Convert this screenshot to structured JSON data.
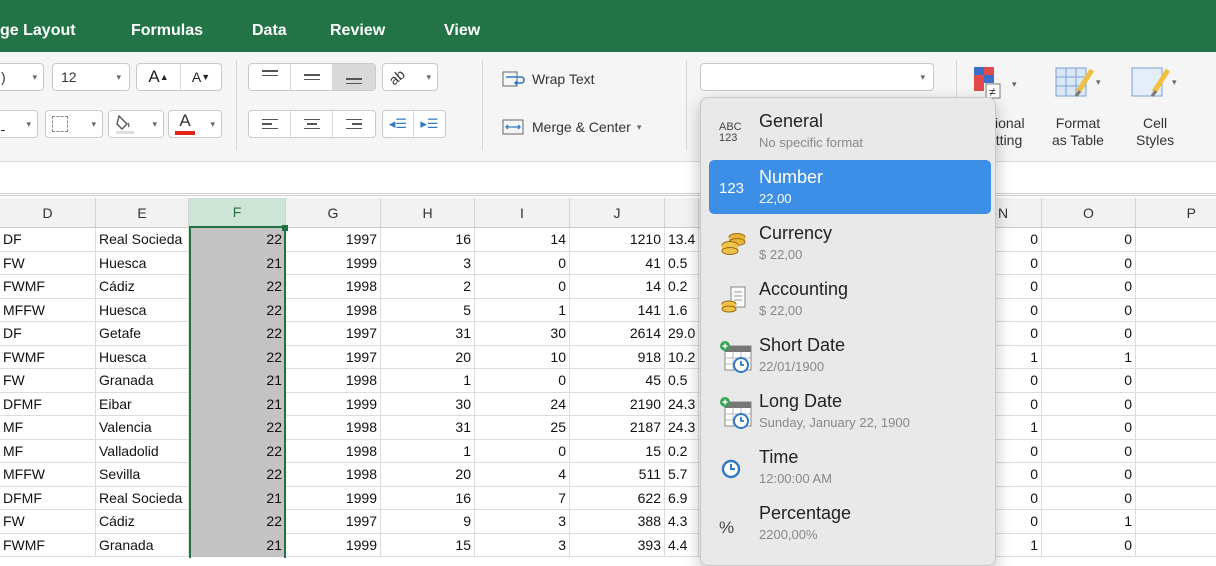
{
  "tabs": [
    "ge Layout",
    "Formulas",
    "Data",
    "Review",
    "View"
  ],
  "ribbon": {
    "font_name_partial": ")",
    "font_size": "12",
    "wrap_text": "Wrap Text",
    "merge_center": "Merge & Center",
    "number_format_value": "",
    "conditional_formatting": [
      "itional",
      "atting"
    ],
    "format_as_table": [
      "Format",
      "as Table"
    ],
    "cell_styles": [
      "Cell",
      "Styles"
    ]
  },
  "columns": [
    "D",
    "E",
    "F",
    "G",
    "H",
    "I",
    "J",
    "N",
    "O",
    "P"
  ],
  "rows": [
    [
      "DF",
      "Real Socieda",
      "22",
      "1997",
      "16",
      "14",
      "1210",
      "13.4",
      "0",
      "0"
    ],
    [
      "FW",
      "Huesca",
      "21",
      "1999",
      "3",
      "0",
      "41",
      "0.5",
      "0",
      "0"
    ],
    [
      "FWMF",
      "Cádiz",
      "22",
      "1998",
      "2",
      "0",
      "14",
      "0.2",
      "0",
      "0"
    ],
    [
      "MFFW",
      "Huesca",
      "22",
      "1998",
      "5",
      "1",
      "141",
      "1.6",
      "0",
      "0"
    ],
    [
      "DF",
      "Getafe",
      "22",
      "1997",
      "31",
      "30",
      "2614",
      "29.0",
      "0",
      "0"
    ],
    [
      "FWMF",
      "Huesca",
      "22",
      "1997",
      "20",
      "10",
      "918",
      "10.2",
      "1",
      "1"
    ],
    [
      "FW",
      "Granada",
      "21",
      "1998",
      "1",
      "0",
      "45",
      "0.5",
      "0",
      "0"
    ],
    [
      "DFMF",
      "Eibar",
      "21",
      "1999",
      "30",
      "24",
      "2190",
      "24.3",
      "0",
      "0"
    ],
    [
      "MF",
      "Valencia",
      "22",
      "1998",
      "31",
      "25",
      "2187",
      "24.3",
      "1",
      "0"
    ],
    [
      "MF",
      "Valladolid",
      "22",
      "1998",
      "1",
      "0",
      "15",
      "0.2",
      "0",
      "0"
    ],
    [
      "MFFW",
      "Sevilla",
      "22",
      "1998",
      "20",
      "4",
      "511",
      "5.7",
      "0",
      "0"
    ],
    [
      "DFMF",
      "Real Socieda",
      "21",
      "1999",
      "16",
      "7",
      "622",
      "6.9",
      "0",
      "0"
    ],
    [
      "FW",
      "Cádiz",
      "22",
      "1997",
      "9",
      "3",
      "388",
      "4.3",
      "0",
      "1"
    ],
    [
      "FWMF",
      "Granada",
      "21",
      "1999",
      "15",
      "3",
      "393",
      "4.4",
      "1",
      "0"
    ]
  ],
  "format_menu": [
    {
      "label": "General",
      "sub": "No specific format",
      "icon": "abc-123-icon",
      "icon_top": "ABC",
      "icon_bottom": "123"
    },
    {
      "label": "Number",
      "sub": "22,00",
      "icon": "number-123-icon",
      "icon_text": "123",
      "active": true
    },
    {
      "label": "Currency",
      "sub": "$ 22,00",
      "icon": "coins-icon"
    },
    {
      "label": "Accounting",
      "sub": "$ 22,00",
      "icon": "ledger-coins-icon"
    },
    {
      "label": "Short Date",
      "sub": "22/01/1900",
      "icon": "calendar-clock-icon"
    },
    {
      "label": "Long Date",
      "sub": "Sunday, January 22, 1900",
      "icon": "calendar-clock-icon"
    },
    {
      "label": "Time",
      "sub": "12:00:00 AM",
      "icon": "clock-icon"
    },
    {
      "label": "Percentage",
      "sub": "2200,00%",
      "icon": "percent-icon",
      "icon_text": "%"
    }
  ],
  "colors": {
    "excel_green": "#227446",
    "selection_green": "#207245",
    "menu_highlight": "#3d8ee7"
  }
}
